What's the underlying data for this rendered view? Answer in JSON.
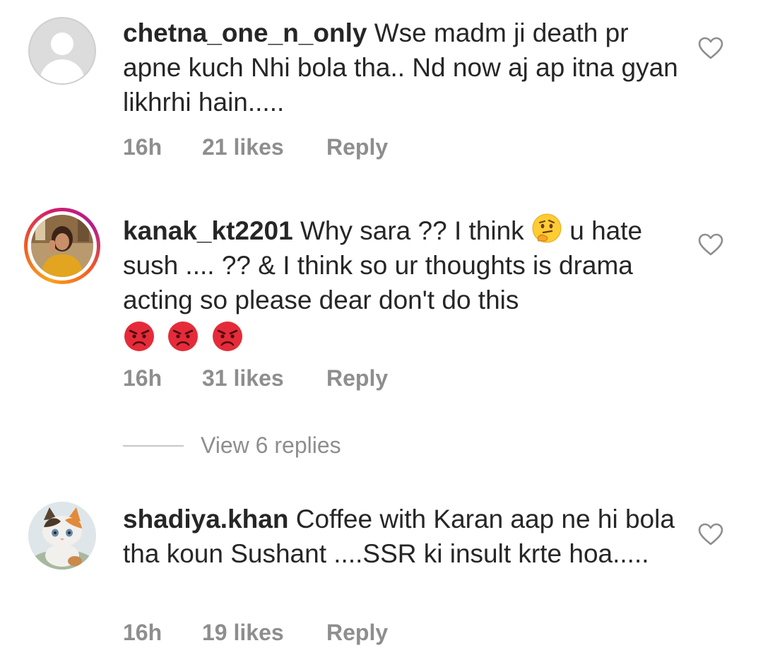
{
  "comments": [
    {
      "username": "chetna_one_n_only",
      "text": " Wse madm ji death pr apne kuch Nhi bola tha.. Nd now aj ap itna gyan likhrhi hain.....",
      "time": "16h",
      "likes": "21 likes",
      "reply": "Reply",
      "avatar": "default-avatar-icon",
      "has_story": false
    },
    {
      "username": "kanak_kt2201",
      "text_before_emoji": " Why sara ?? I think ",
      "inline_emoji": "thinking-face",
      "text_after_emoji": " u hate sush .... ?? & I think so ur thoughts is drama acting so please dear don't do this",
      "trailing_emojis": [
        "angry-face",
        "angry-face",
        "angry-face"
      ],
      "time": "16h",
      "likes": "31 likes",
      "reply": "Reply",
      "avatar": "user-photo",
      "has_story": true
    },
    {
      "username": "shadiya.khan",
      "text": " Coffee with Karan aap ne hi bola tha koun Sushant ....SSR ki insult krte hoa.....",
      "time": "16h",
      "likes": "19 likes",
      "reply": "Reply",
      "avatar": "kitten-photo",
      "has_story": false
    }
  ],
  "view_replies": {
    "label": "View 6 replies"
  },
  "colors": {
    "text": "#262626",
    "meta": "#8e8e8e",
    "divider": "#c7c7c7",
    "angry_face": "#e52b39",
    "thinking_face": "#ffcc33"
  }
}
